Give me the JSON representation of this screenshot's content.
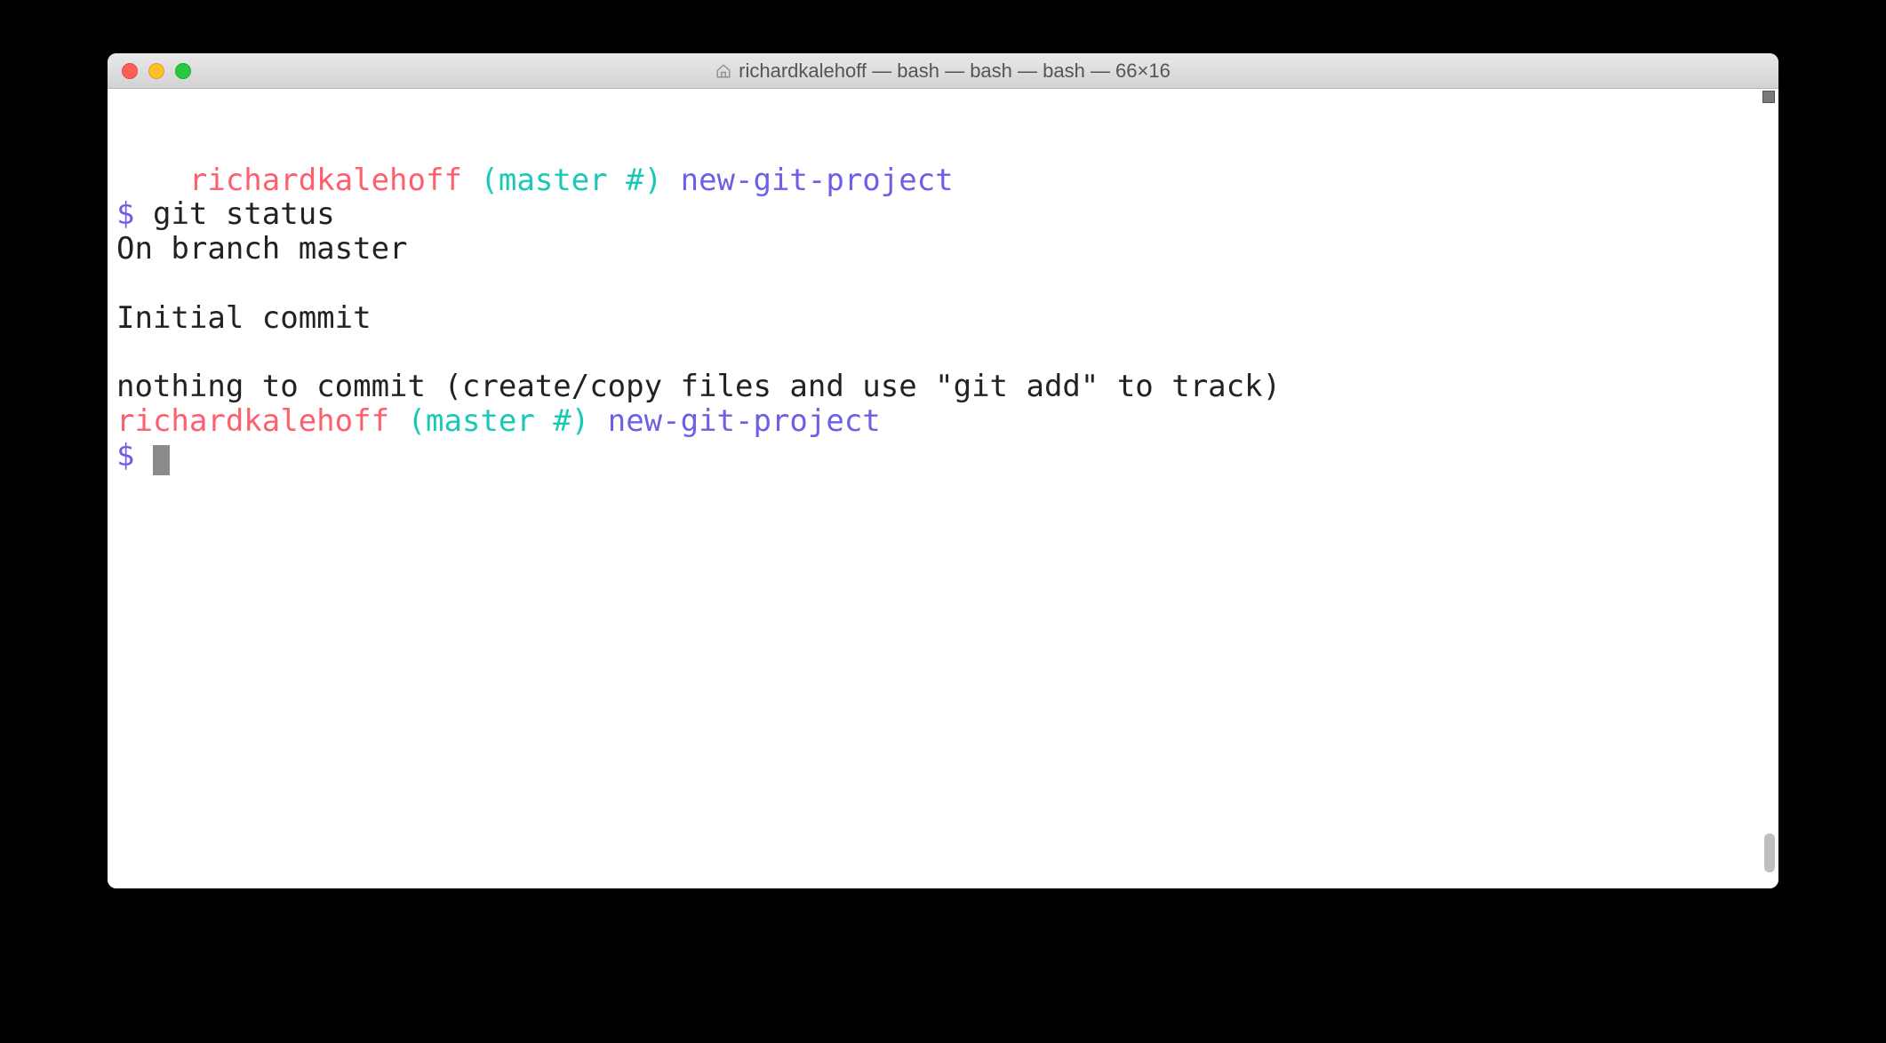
{
  "window": {
    "title": "richardkalehoff — bash — bash — bash — 66×16"
  },
  "prompt1": {
    "user": "richardkalehoff",
    "branch": "(master #)",
    "path": "new-git-project",
    "symbol": "$",
    "command": "git status"
  },
  "output": {
    "line1": "On branch master",
    "line2": "",
    "line3": "Initial commit",
    "line4": "",
    "line5": "nothing to commit (create/copy files and use \"git add\" to track)"
  },
  "prompt2": {
    "user": "richardkalehoff",
    "branch": "(master #)",
    "path": "new-git-project",
    "symbol": "$"
  }
}
